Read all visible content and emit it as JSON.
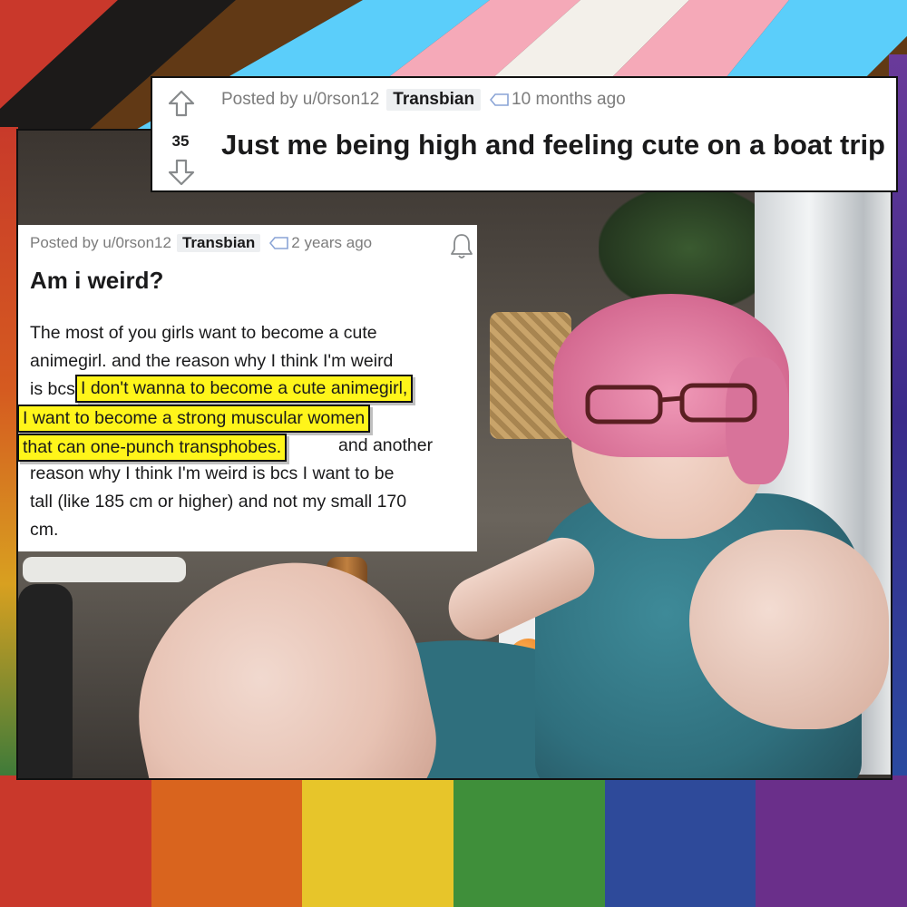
{
  "background": {
    "flag_stripes": [
      "#c9382b",
      "#d9641e",
      "#e7c52a",
      "#3f8f3a",
      "#2e4a9a",
      "#6a2f8a"
    ],
    "chevrons": [
      "#f5a9b8",
      "#5bcefa",
      "#ffffff",
      "#613915",
      "#000000"
    ]
  },
  "top_post": {
    "votes": "35",
    "posted_by": "Posted by u/0rson12",
    "flair": "Transbian",
    "age": "10 months ago",
    "title": "Just me being high and feeling cute on a boat trip",
    "icons": [
      "upvote-arrow-icon",
      "downvote-arrow-icon",
      "tag-icon"
    ]
  },
  "text_post": {
    "posted_by": "Posted by u/0rson12",
    "flair": "Transbian",
    "age": "2 years ago",
    "title": "Am i weird?",
    "body_lines": [
      "The most of you girls want to become a cute",
      "animegirl. and the reason why I think I'm weird",
      "is bcs",
      "",
      "",
      "reason why I think I'm weird is bcs I want to be",
      "tall (like 185 cm or higher) and not my small 170",
      "cm."
    ],
    "highlight_lines": [
      "I don't wanna to become a cute animegirl,",
      "I want to become a strong muscular women",
      "that can one-punch transphobes."
    ],
    "after_highlight": "and another",
    "icons": [
      "bell-icon",
      "tag-icon"
    ],
    "highlight_color": "#fff51a"
  }
}
